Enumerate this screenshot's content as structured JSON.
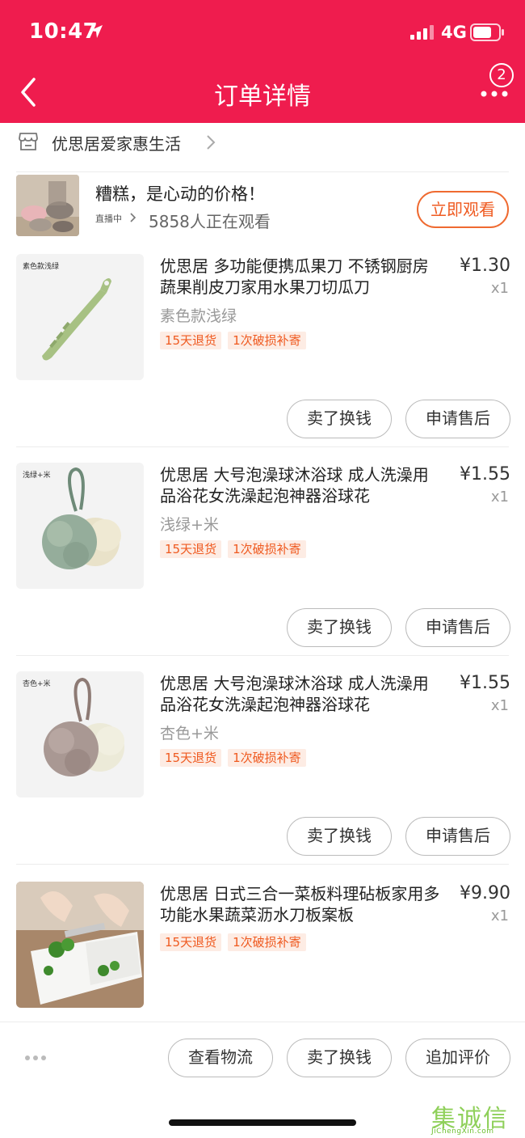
{
  "status_bar": {
    "time": "10:47",
    "network": "4G"
  },
  "header": {
    "title": "订单详情",
    "badge_count": "2"
  },
  "store": {
    "name": "优思居爱家惠生活"
  },
  "live": {
    "title": "糟糕，是心动的价格！",
    "tag": "直播中",
    "viewers": "5858人正在观看",
    "watch_label": "立即观看"
  },
  "items": [
    {
      "thumb_label": "素色款浅绿",
      "title": "优思居 多功能便携瓜果刀 不锈钢厨房蔬果削皮刀家用水果刀切瓜刀",
      "price": "¥1.30",
      "qty": "x1",
      "variant": "素色款浅绿",
      "tags": [
        "15天退货",
        "1次破损补寄"
      ],
      "btn_resell": "卖了换钱",
      "btn_after_sale": "申请售后"
    },
    {
      "thumb_label": "浅绿+米",
      "title": "优思居 大号泡澡球沐浴球 成人洗澡用品浴花女洗澡起泡神器浴球花",
      "price": "¥1.55",
      "qty": "x1",
      "variant": "浅绿+米",
      "tags": [
        "15天退货",
        "1次破损补寄"
      ],
      "btn_resell": "卖了换钱",
      "btn_after_sale": "申请售后"
    },
    {
      "thumb_label": "杏色+米",
      "title": "优思居 大号泡澡球沐浴球 成人洗澡用品浴花女洗澡起泡神器浴球花",
      "price": "¥1.55",
      "qty": "x1",
      "variant": "杏色+米",
      "tags": [
        "15天退货",
        "1次破损补寄"
      ],
      "btn_resell": "卖了换钱",
      "btn_after_sale": "申请售后"
    },
    {
      "title": "优思居 日式三合一菜板料理砧板家用多功能水果蔬菜沥水刀板案板",
      "price": "¥9.90",
      "qty": "x1",
      "tags": [
        "15天退货",
        "1次破损补寄"
      ]
    }
  ],
  "bottom_bar": {
    "logistics": "查看物流",
    "resell": "卖了换钱",
    "add_review": "追加评价"
  },
  "watermark": {
    "chars": "集诚信",
    "url": "JiChengXin.com"
  },
  "colors": {
    "brand": "#ef1c4e",
    "accent": "#ef5a20",
    "tag_bg": "#fdece4"
  }
}
